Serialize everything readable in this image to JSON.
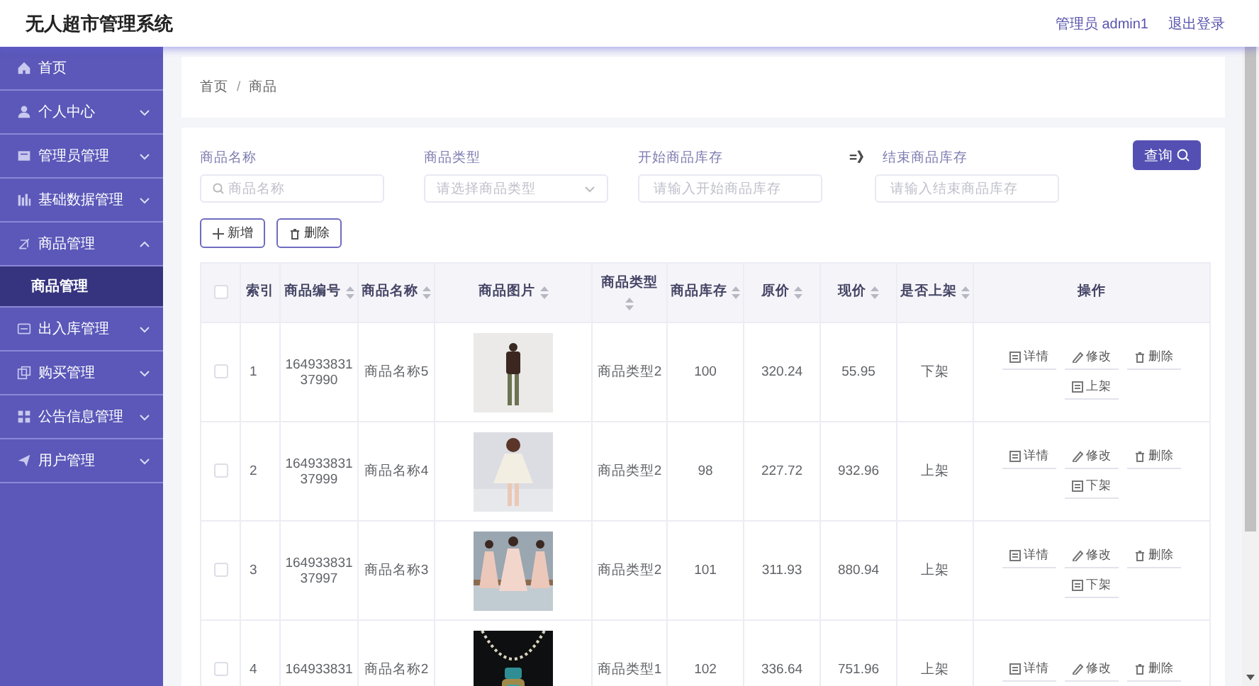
{
  "app": {
    "title": "无人超市管理系统",
    "user": "管理员 admin1",
    "logout": "退出登录"
  },
  "sidebar": {
    "items": [
      {
        "label": "首页",
        "kind": "link"
      },
      {
        "label": "个人中心",
        "kind": "group",
        "expanded": false
      },
      {
        "label": "管理员管理",
        "kind": "group",
        "expanded": false
      },
      {
        "label": "基础数据管理",
        "kind": "group",
        "expanded": false
      },
      {
        "label": "商品管理",
        "kind": "group",
        "expanded": true,
        "children": [
          {
            "label": "商品管理",
            "selected": true
          }
        ]
      },
      {
        "label": "出入库管理",
        "kind": "group",
        "expanded": false
      },
      {
        "label": "购买管理",
        "kind": "group",
        "expanded": false
      },
      {
        "label": "公告信息管理",
        "kind": "group",
        "expanded": false
      },
      {
        "label": "用户管理",
        "kind": "group",
        "expanded": false
      }
    ]
  },
  "breadcrumb": {
    "items": [
      "首页",
      "商品"
    ],
    "separator": "/"
  },
  "filters": [
    {
      "label": "商品名称",
      "placeholder": "商品名称",
      "kind": "search"
    },
    {
      "label": "商品类型",
      "placeholder": "请选择商品类型",
      "kind": "select"
    },
    {
      "label": "开始商品库存",
      "placeholder": "请输入开始商品库存",
      "kind": "text"
    },
    {
      "label": "结束商品库存",
      "placeholder": "请输入结束商品库存",
      "kind": "text",
      "prefix": "=》"
    }
  ],
  "query_button": "查询",
  "toolbar": [
    {
      "label": "新增",
      "kind": "add"
    },
    {
      "label": "删除",
      "kind": "delete"
    }
  ],
  "table": {
    "select_all": {
      "checked": false
    },
    "columns": [
      {
        "label": "索引",
        "sortable": false
      },
      {
        "label": "商品编号",
        "sortable": true
      },
      {
        "label": "商品名称",
        "sortable": true
      },
      {
        "label": "商品图片",
        "sortable": true
      },
      {
        "label": "商品类型",
        "sortable": true
      },
      {
        "label": "商品库存",
        "sortable": true
      },
      {
        "label": "原价",
        "sortable": true
      },
      {
        "label": "现价",
        "sortable": true
      },
      {
        "label": "是否上架",
        "sortable": true
      },
      {
        "label": "操作",
        "sortable": false
      }
    ],
    "rows": [
      {
        "checked": false,
        "cells": [
          "1",
          "16493383137990",
          "商品名称5",
          null,
          "商品类型2",
          "100",
          "320.24",
          "55.95",
          "下架"
        ],
        "actions": [
          {
            "label": "详情",
            "kind": "detail"
          },
          {
            "label": "修改",
            "kind": "edit"
          },
          {
            "label": "删除",
            "kind": "delete"
          },
          {
            "label": "上架",
            "kind": "shelf"
          }
        ]
      },
      {
        "checked": false,
        "cells": [
          "2",
          "16493383137999",
          "商品名称4",
          null,
          "商品类型2",
          "98",
          "227.72",
          "932.96",
          "上架"
        ],
        "actions": [
          {
            "label": "详情",
            "kind": "detail"
          },
          {
            "label": "修改",
            "kind": "edit"
          },
          {
            "label": "删除",
            "kind": "delete"
          },
          {
            "label": "下架",
            "kind": "shelf"
          }
        ]
      },
      {
        "checked": false,
        "cells": [
          "3",
          "16493383137997",
          "商品名称3",
          null,
          "商品类型2",
          "101",
          "311.93",
          "880.94",
          "上架"
        ],
        "actions": [
          {
            "label": "详情",
            "kind": "detail"
          },
          {
            "label": "修改",
            "kind": "edit"
          },
          {
            "label": "删除",
            "kind": "delete"
          },
          {
            "label": "下架",
            "kind": "shelf"
          }
        ]
      },
      {
        "checked": false,
        "cells": [
          "4",
          "164933831",
          "商品名称2",
          null,
          "商品类型1",
          "102",
          "336.64",
          "751.96",
          "上架"
        ],
        "actions": [
          {
            "label": "详情",
            "kind": "detail"
          },
          {
            "label": "修改",
            "kind": "edit"
          },
          {
            "label": "删除",
            "kind": "delete"
          }
        ]
      }
    ]
  }
}
